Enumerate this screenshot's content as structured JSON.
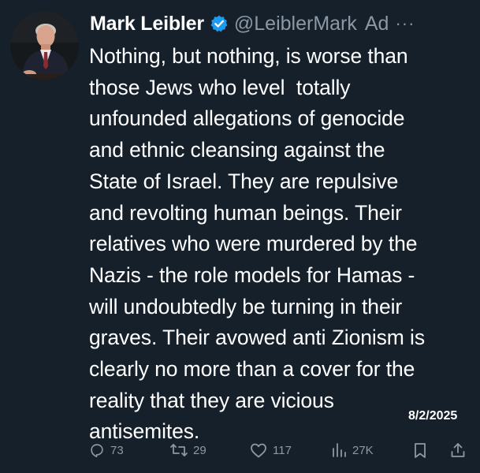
{
  "author": {
    "display_name": "Mark Leibler",
    "handle": "@LeiblerMark",
    "ad_label": "Ad",
    "more": "···"
  },
  "tweet": {
    "lines": [
      "Nothing, but nothing, is worse than",
      "those Jews who level  totally",
      "unfounded allegations of genocide",
      "and ethnic cleansing against the",
      "State of Israel. They are repulsive",
      "and revolting human beings. Their",
      "relatives who were murdered by the",
      "Nazis - the role models for Hamas -",
      "will undoubtedly be turning in their",
      "graves. Their avowed anti Zionism is",
      "clearly no more than a cover for the",
      "reality that they are vicious",
      "antisemites."
    ],
    "date_stamp": "8/2/2025"
  },
  "actions": {
    "replies": "73",
    "reposts": "29",
    "likes": "117",
    "views": "27K"
  },
  "colors": {
    "background": "#15202b",
    "text": "#ffffff",
    "muted": "#8b98a5",
    "verified": "#1d9bf0"
  },
  "icons": [
    "reply-icon",
    "repost-icon",
    "like-icon",
    "views-icon",
    "bookmark-icon",
    "share-icon",
    "verified-badge-icon"
  ]
}
